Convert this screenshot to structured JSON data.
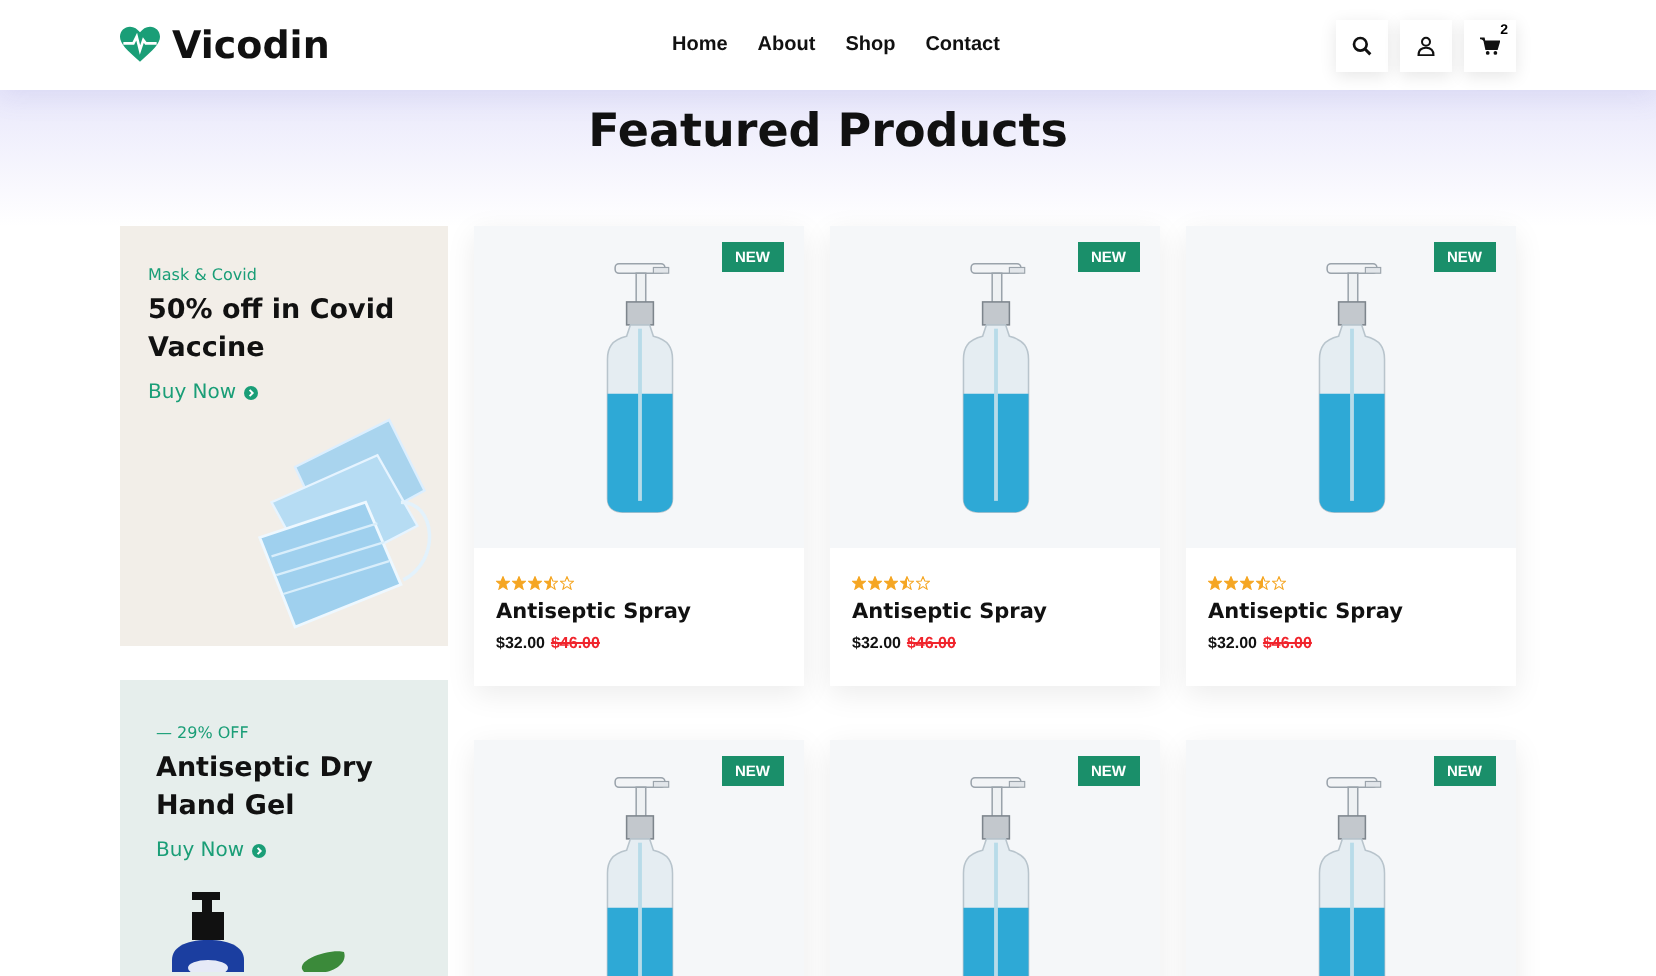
{
  "header": {
    "logo": "Vicodin",
    "nav": [
      {
        "label": "Home"
      },
      {
        "label": "About"
      },
      {
        "label": "Shop"
      },
      {
        "label": "Contact"
      }
    ],
    "cart_count": "2"
  },
  "section": {
    "title": "Featured Products"
  },
  "promos": [
    {
      "kind": "mask",
      "eyebrow": "Mask & Covid",
      "title": "50% off in Covid Vaccine",
      "link": "Buy Now"
    },
    {
      "kind": "gel",
      "eyebrow": "— 29% OFF",
      "title": "Antiseptic Dry Hand Gel",
      "link": "Buy Now"
    }
  ],
  "products": [
    {
      "badge": "NEW",
      "stars": 3.5,
      "name": "Antiseptic Spray",
      "price": "$32.00",
      "old_price": "$46.00"
    },
    {
      "badge": "NEW",
      "stars": 3.5,
      "name": "Antiseptic Spray",
      "price": "$32.00",
      "old_price": "$46.00"
    },
    {
      "badge": "NEW",
      "stars": 3.5,
      "name": "Antiseptic Spray",
      "price": "$32.00",
      "old_price": "$46.00"
    },
    {
      "badge": "NEW"
    },
    {
      "badge": "NEW"
    },
    {
      "badge": "NEW"
    }
  ]
}
